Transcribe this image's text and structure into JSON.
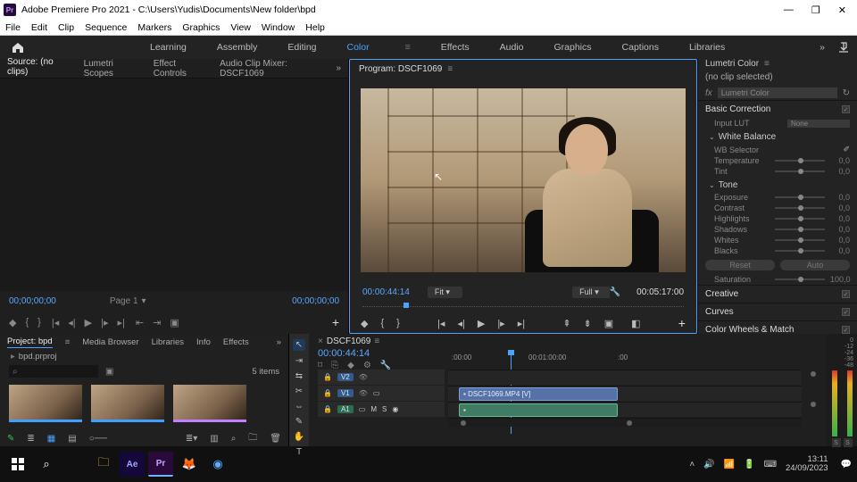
{
  "titlebar": {
    "appicon": "Pr",
    "title": "Adobe Premiere Pro 2021 - C:\\Users\\Yudis\\Documents\\New folder\\bpd"
  },
  "menu": {
    "items": [
      "File",
      "Edit",
      "Clip",
      "Sequence",
      "Markers",
      "Graphics",
      "View",
      "Window",
      "Help"
    ]
  },
  "workspaces": {
    "items": [
      "Learning",
      "Assembly",
      "Editing",
      "Color",
      "Effects",
      "Audio",
      "Graphics",
      "Captions",
      "Libraries"
    ],
    "active": "Color"
  },
  "source": {
    "tabs": [
      "Source: (no clips)",
      "Lumetri Scopes",
      "Effect Controls",
      "Audio Clip Mixer: DSCF1069"
    ],
    "activeTab": "Source: (no clips)",
    "tc_in": "00;00;00;00",
    "page": "Page 1",
    "tc_out": "00;00;00;00"
  },
  "program": {
    "title": "Program: DSCF1069",
    "tc": "00:00:44:14",
    "fit": "Fit",
    "qual": "Full",
    "dur": "00:05:17:00"
  },
  "lumetri": {
    "panel": "Lumetri Color",
    "noclip": "(no clip selected)",
    "fxname": "Lumetri Color",
    "sections": {
      "basic": "Basic Correction",
      "inputlut": "Input LUT",
      "inputlut_val": "None",
      "whitebalance": "White Balance",
      "wbselector": "WB Selector",
      "temperature": "Temperature",
      "tint": "Tint",
      "tone": "Tone",
      "exposure": "Exposure",
      "contrast": "Contrast",
      "highlights": "Highlights",
      "shadows": "Shadows",
      "whites": "Whites",
      "blacks": "Blacks",
      "reset": "Reset",
      "auto": "Auto",
      "saturation": "Saturation",
      "creative": "Creative",
      "curves": "Curves",
      "colorwheels": "Color Wheels & Match"
    },
    "vals": {
      "zero": "0,0",
      "sat": "100,0"
    }
  },
  "project": {
    "tabs": [
      "Project: bpd",
      "Media Browser",
      "Libraries",
      "Info",
      "Effects"
    ],
    "activeTab": "Project: bpd",
    "filename": "bpd.prproj",
    "itemcount": "5 items"
  },
  "timeline": {
    "seqname": "DSCF1069",
    "tc": "00:00:44:14",
    "ruler": {
      "t0": ":00:00",
      "t1": "00:01:00:00",
      "t2": ":00"
    },
    "tracks": {
      "v2": "V2",
      "v1": "V1",
      "a1": "A1",
      "m": "M",
      "s": "S"
    },
    "clipname": "DSCF1069.MP4 [V]"
  },
  "meters": {
    "ticks": [
      "0",
      "-12",
      "-24",
      "-36",
      "-48"
    ],
    "s": "S"
  },
  "taskbar": {
    "time": "13:11",
    "date": "24/09/2023"
  }
}
